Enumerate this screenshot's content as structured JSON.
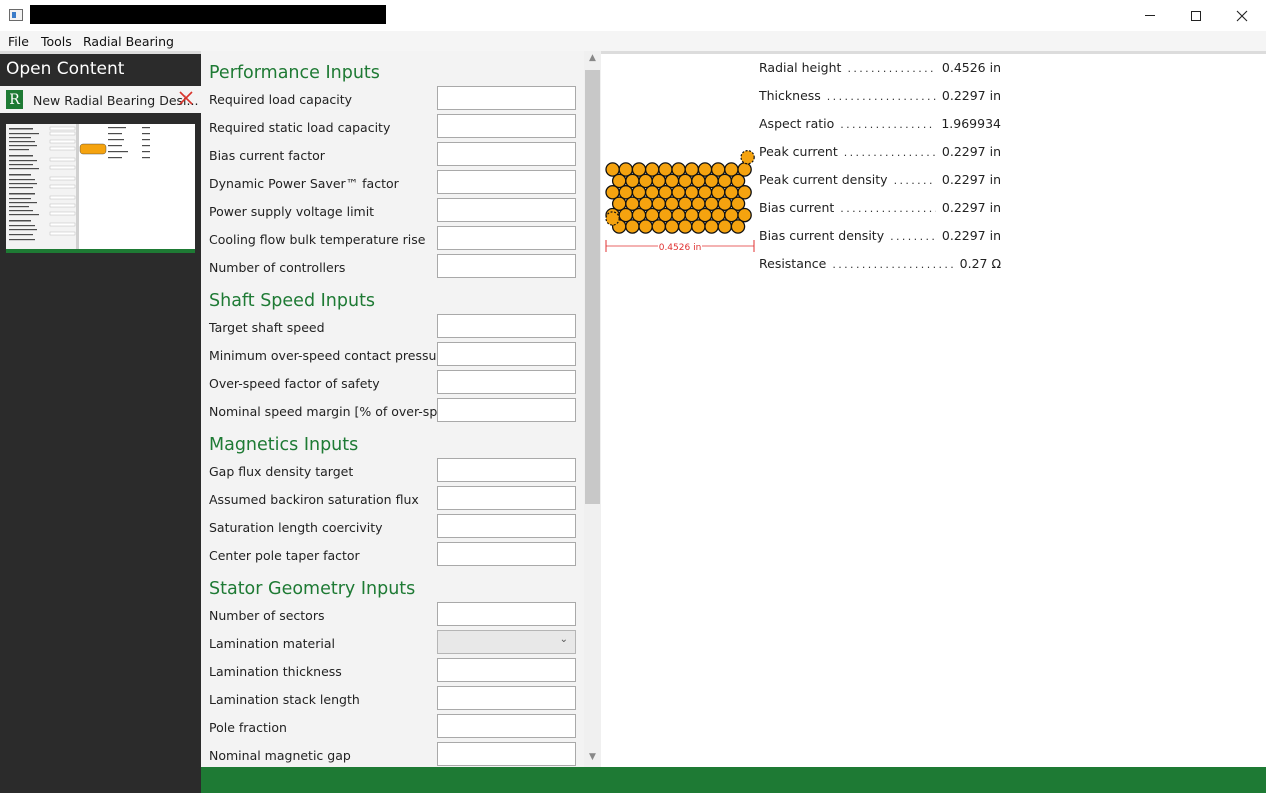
{
  "window": {
    "minimize_icon": "minimize-icon",
    "maximize_icon": "maximize-icon",
    "close_icon": "close-icon"
  },
  "menu": {
    "items": [
      "File",
      "Tools",
      "Radial Bearing"
    ]
  },
  "open_content": {
    "title": "Open Content",
    "tab_badge": "R",
    "tab_label": "New Radial Bearing Desi...",
    "tab_close_icon": "close-x-icon"
  },
  "sections": {
    "performance": {
      "title": "Performance Inputs",
      "fields": [
        {
          "label": "Required load capacity",
          "value": ""
        },
        {
          "label": "Required static load capacity",
          "value": ""
        },
        {
          "label": "Bias current factor",
          "value": ""
        },
        {
          "label": "Dynamic Power Saver™ factor",
          "value": ""
        },
        {
          "label": "Power supply voltage limit",
          "value": ""
        },
        {
          "label": "Cooling flow bulk temperature rise",
          "value": ""
        },
        {
          "label": "Number of controllers",
          "value": ""
        }
      ]
    },
    "shaft_speed": {
      "title": "Shaft Speed Inputs",
      "fields": [
        {
          "label": "Target shaft speed",
          "value": ""
        },
        {
          "label": "Minimum over-speed contact pressure",
          "value": ""
        },
        {
          "label": "Over-speed factor of safety",
          "value": ""
        },
        {
          "label": "Nominal speed margin [% of over-speed]",
          "value": ""
        }
      ]
    },
    "magnetics": {
      "title": "Magnetics Inputs",
      "fields": [
        {
          "label": "Gap flux density target",
          "value": ""
        },
        {
          "label": "Assumed backiron saturation flux",
          "value": ""
        },
        {
          "label": "Saturation length coercivity",
          "value": ""
        },
        {
          "label": "Center pole taper factor",
          "value": ""
        }
      ]
    },
    "stator": {
      "title": "Stator Geometry Inputs",
      "fields": [
        {
          "label": "Number of sectors",
          "value": ""
        },
        {
          "label": "Lamination material",
          "value": ""
        },
        {
          "label": "Lamination thickness",
          "value": ""
        },
        {
          "label": "Lamination stack length",
          "value": ""
        },
        {
          "label": "Pole fraction",
          "value": ""
        },
        {
          "label": "Nominal magnetic gap",
          "value": ""
        }
      ]
    }
  },
  "drawing": {
    "dimension_label": "0.4526 in",
    "wire_color": "#f5a30f",
    "dimension_color": "#e03030"
  },
  "results": [
    {
      "label": "Radial height",
      "value": "0.4526 in"
    },
    {
      "label": "Thickness",
      "value": "0.2297 in"
    },
    {
      "label": "Aspect ratio",
      "value": "1.969934"
    },
    {
      "label": "Peak current",
      "value": "0.2297 in"
    },
    {
      "label": "Peak current density",
      "value": "0.2297 in"
    },
    {
      "label": "Bias current",
      "value": "0.2297 in"
    },
    {
      "label": "Bias current density",
      "value": "0.2297 in"
    },
    {
      "label": "Resistance",
      "value": "0.27 Ω"
    }
  ],
  "colors": {
    "accent": "#1e7a34",
    "panel_dark": "#2b2b2b",
    "close_red": "#d9342b"
  }
}
